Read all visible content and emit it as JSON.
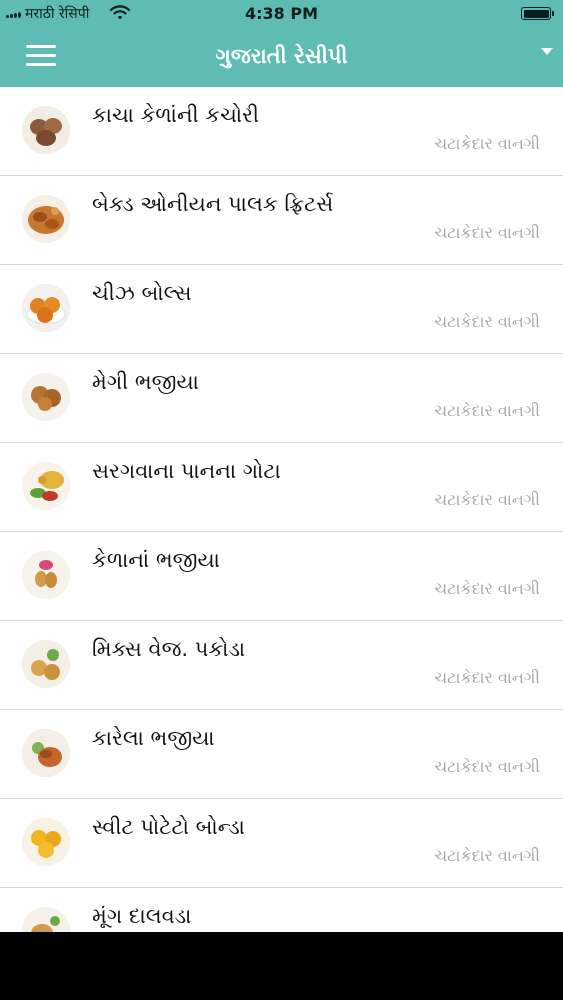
{
  "status_bar": {
    "carrier": "मराठी रेसिपी",
    "time": "4:38 PM",
    "signal_icon": "signal-dots-icon",
    "wifi_icon": "wifi-icon",
    "battery_icon": "battery-icon",
    "battery_level": 1.0
  },
  "header": {
    "title": "ગુજરાતી રેસીપી",
    "menu_icon": "hamburger-menu-icon",
    "dropdown_icon": "caret-down-icon"
  },
  "colors": {
    "accent": "#5fbcb4",
    "row_title": "#111111",
    "row_category": "#a6a6a6",
    "divider": "#d9d9d9"
  },
  "recipes": [
    {
      "title": "કાચા કેળાંની કચોરી",
      "category": "ચટાકેદાર વાનગી"
    },
    {
      "title": "બેક્ડ ઓનીયન પાલક ફ્રિટર્સ",
      "category": "ચટાકેદાર વાનગી"
    },
    {
      "title": "ચીઝ બોલ્સ",
      "category": "ચટાકેદાર વાનગી"
    },
    {
      "title": "મેગી ભજીયા",
      "category": "ચટાકેદાર વાનગી"
    },
    {
      "title": "સરગવાના પાનના ગોટા",
      "category": "ચટાકેદાર વાનગી"
    },
    {
      "title": "કેળાનાં ભજીયા",
      "category": "ચટાકેદાર વાનગી"
    },
    {
      "title": "મિક્સ વેજ. પકોડા",
      "category": "ચટાકેદાર વાનગી"
    },
    {
      "title": "કારેલા ભજીયા",
      "category": "ચટાકેદાર વાનગી"
    },
    {
      "title": "સ્વીટ પોટેટો બોન્ડા",
      "category": "ચટાકેદાર વાનગી"
    },
    {
      "title": "મૂંગ દાલવડા",
      "category": "ચટાકેદાર વાનગી"
    }
  ]
}
